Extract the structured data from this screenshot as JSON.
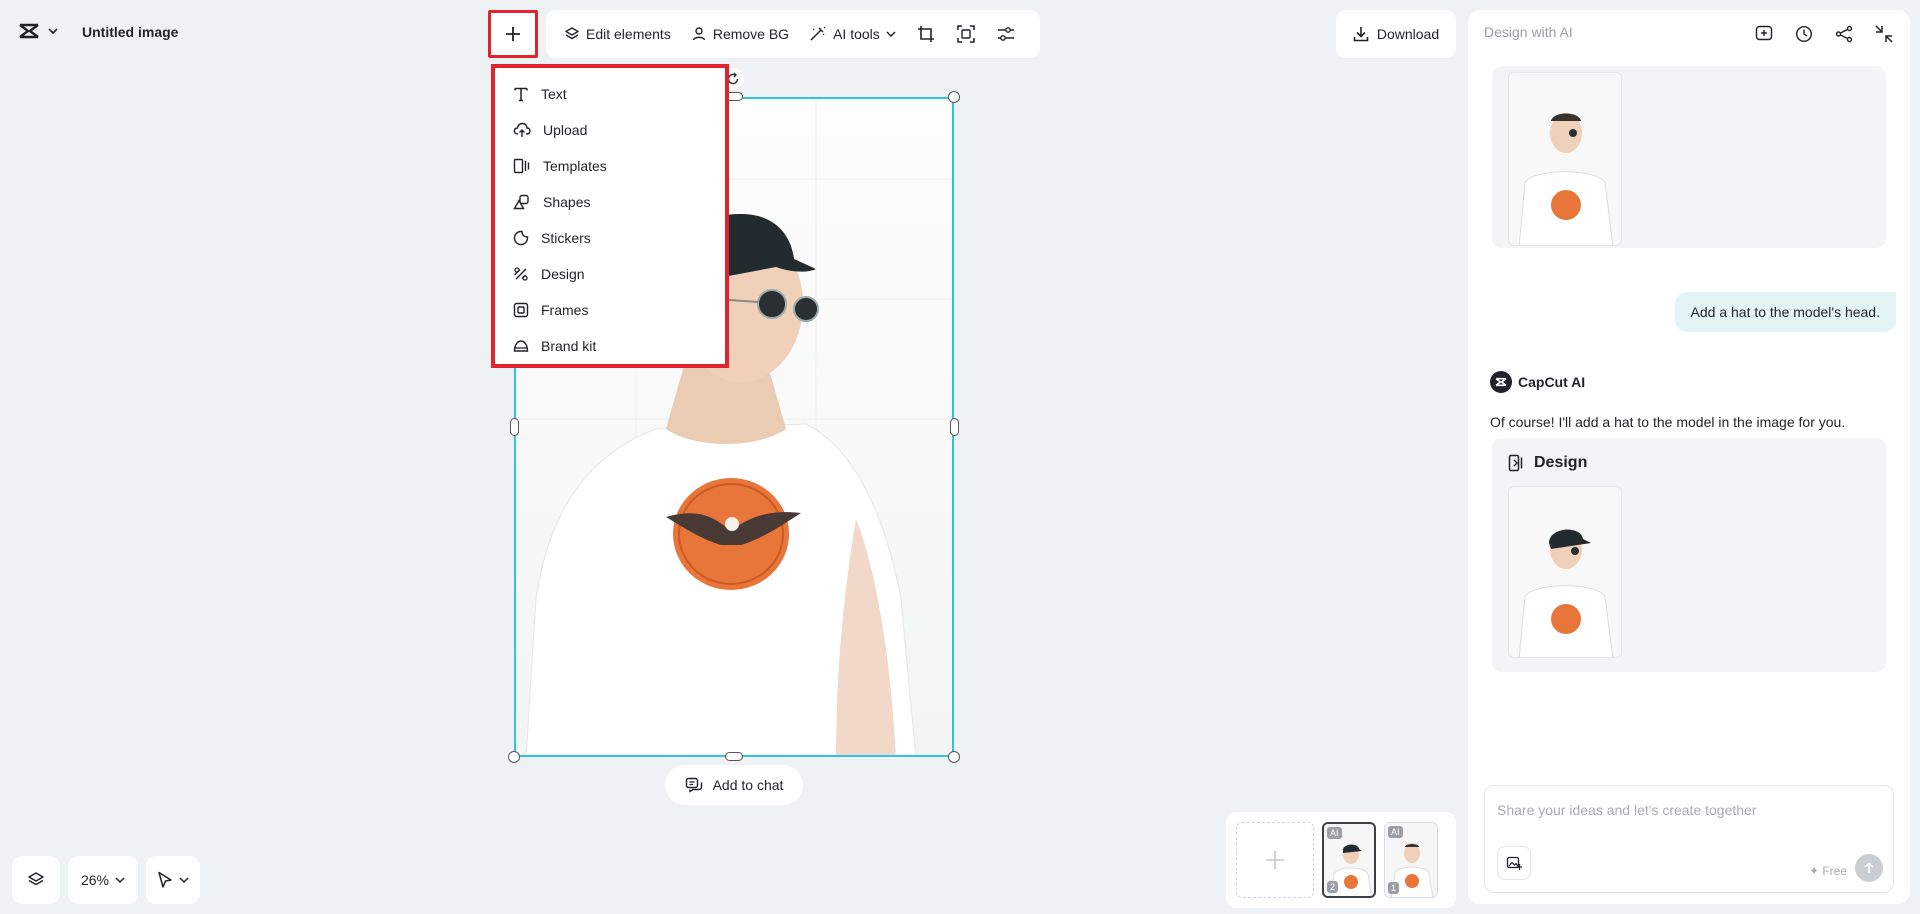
{
  "header": {
    "title": "Untitled image",
    "logo_icon": "capcut-logo-icon",
    "add_icon": "plus-icon"
  },
  "toolbar": {
    "edit_elements": "Edit elements",
    "remove_bg": "Remove BG",
    "ai_tools": "AI tools",
    "download": "Download"
  },
  "menu": {
    "items": [
      {
        "label": "Text",
        "icon": "text-icon"
      },
      {
        "label": "Upload",
        "icon": "upload-icon"
      },
      {
        "label": "Templates",
        "icon": "templates-icon"
      },
      {
        "label": "Shapes",
        "icon": "shapes-icon"
      },
      {
        "label": "Stickers",
        "icon": "stickers-icon"
      },
      {
        "label": "Design",
        "icon": "design-icon"
      },
      {
        "label": "Frames",
        "icon": "frames-icon"
      },
      {
        "label": "Brand kit",
        "icon": "brand-kit-icon"
      }
    ]
  },
  "canvas": {
    "add_to_chat": "Add to chat"
  },
  "bottom": {
    "zoom": "26%"
  },
  "thumbnails": [
    {
      "badge_ai": "AI",
      "number": "2",
      "selected": true
    },
    {
      "badge_ai": "AI",
      "number": "1",
      "selected": false
    }
  ],
  "panel": {
    "title": "Design with AI",
    "user_message": "Add a hat to the model's head.",
    "ai_name": "CapCut AI",
    "ai_message": "Of course! I'll add a hat to the model in the image for you.",
    "card_title": "Design",
    "input_placeholder": "Share your ideas and let's create together",
    "free_label": "✦ Free"
  },
  "colors": {
    "accent_red": "#e0242e",
    "selection": "#2ec3df",
    "shirt_badge": "#e8763a"
  }
}
